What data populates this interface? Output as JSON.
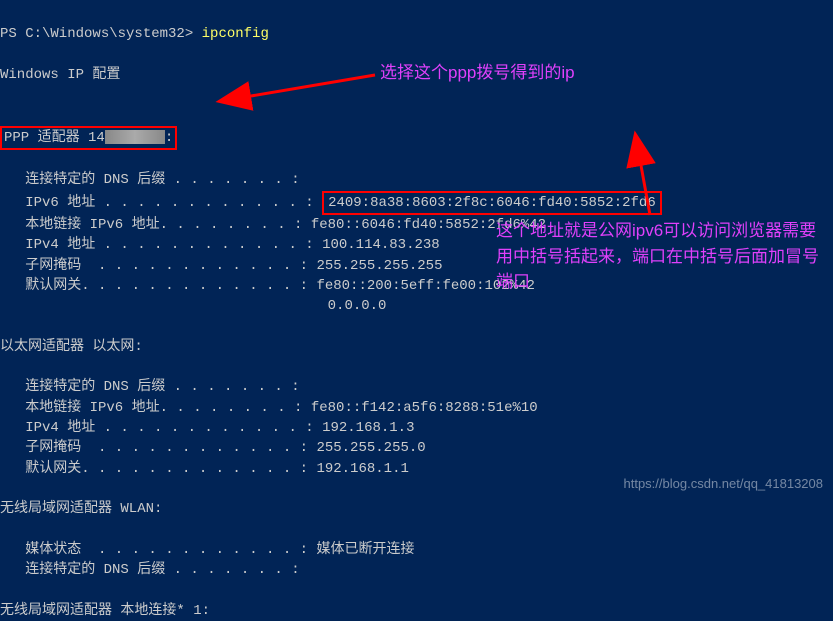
{
  "prompt": {
    "prefix": "PS C:\\Windows\\system32> ",
    "command": "ipconfig"
  },
  "heading": "Windows IP 配置",
  "adapter1": {
    "title_prefix": "PPP 适配器 14",
    "title_suffix": ":",
    "lines": {
      "dns_suffix_label": "   连接特定的 DNS 后缀 . . . . . . . :",
      "ipv6_label": "   IPv6 地址 . . . . . . . . . . . . : ",
      "ipv6_value": "2409:8a38:8603:2f8c:6046:fd40:5852:2fd6",
      "linklocal_label": "   本地链接 IPv6 地址. . . . . . . . : ",
      "linklocal_value": "fe80::6046:fd40:5852:2fd6%42",
      "ipv4_label": "   IPv4 地址 . . . . . . . . . . . . : ",
      "ipv4_value": "100.114.83.238",
      "mask_label": "   子网掩码  . . . . . . . . . . . . : ",
      "mask_value": "255.255.255.255",
      "gw_label": "   默认网关. . . . . . . . . . . . . : ",
      "gw_value1": "fe80::200:5eff:fe00:102%42",
      "gw_value2": "                                       0.0.0.0"
    }
  },
  "adapter2": {
    "title": "以太网适配器 以太网:",
    "lines": {
      "dns_suffix_label": "   连接特定的 DNS 后缀 . . . . . . . :",
      "linklocal_label": "   本地链接 IPv6 地址. . . . . . . . : ",
      "linklocal_value": "fe80::f142:a5f6:8288:51e%10",
      "ipv4_label": "   IPv4 地址 . . . . . . . . . . . . : ",
      "ipv4_value": "192.168.1.3",
      "mask_label": "   子网掩码  . . . . . . . . . . . . : ",
      "mask_value": "255.255.255.0",
      "gw_label": "   默认网关. . . . . . . . . . . . . : ",
      "gw_value": "192.168.1.1"
    }
  },
  "adapter3": {
    "title": "无线局域网适配器 WLAN:",
    "lines": {
      "media_label": "   媒体状态  . . . . . . . . . . . . : ",
      "media_value": "媒体已断开连接",
      "dns_suffix_label": "   连接特定的 DNS 后缀 . . . . . . . :"
    }
  },
  "adapter4": {
    "title": "无线局域网适配器 本地连接* 1:"
  },
  "annotations": {
    "top": "选择这个ppp拨号得到的ip",
    "bottom": "这个地址就是公网ipv6可以访问浏览器需要用中括号括起来，端口在中括号后面加冒号端口"
  },
  "watermark": "https://blog.csdn.net/qq_41813208"
}
